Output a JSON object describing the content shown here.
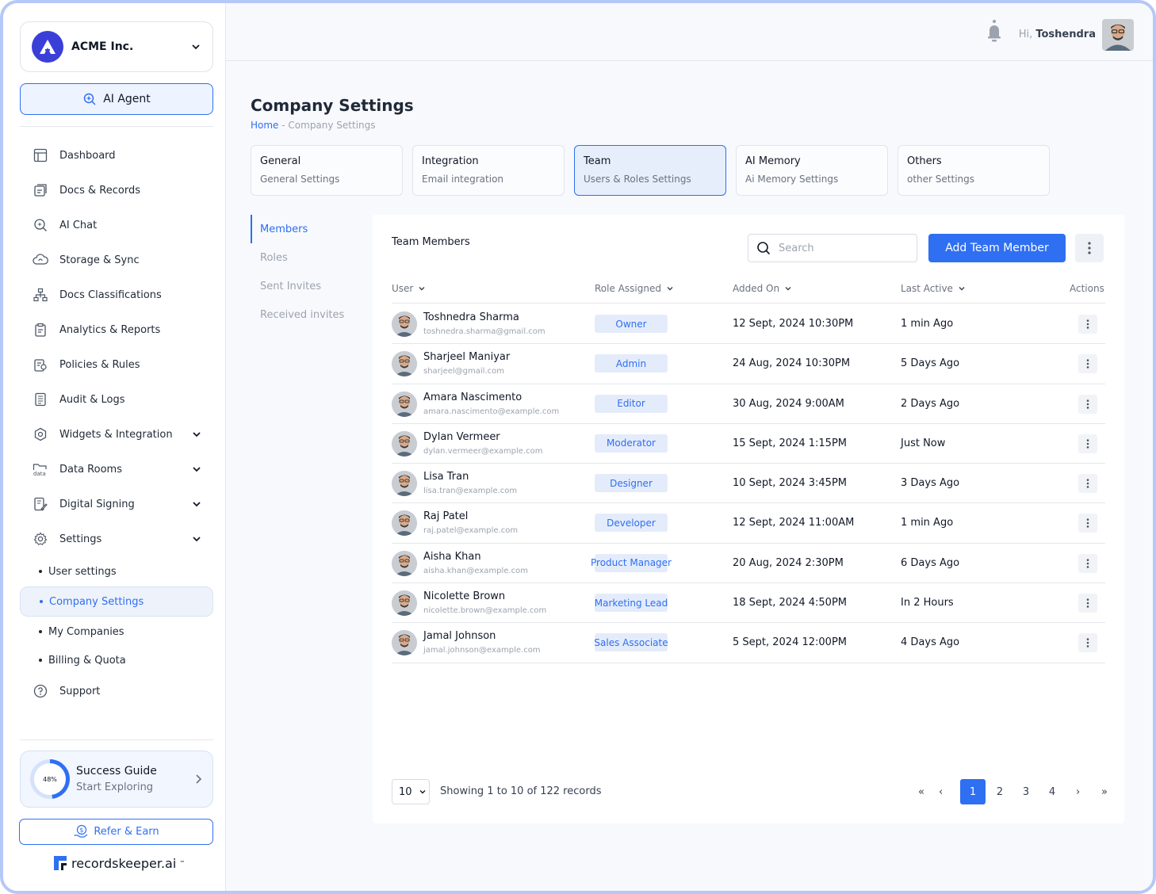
{
  "org": {
    "name": "ACME Inc.",
    "logo_letter": "A"
  },
  "ai_agent": {
    "label": "AI Agent"
  },
  "nav": [
    {
      "label": "Dashboard",
      "icon": "dashboard-icon"
    },
    {
      "label": "Docs & Records",
      "icon": "docs-icon"
    },
    {
      "label": "AI Chat",
      "icon": "ai-chat-icon"
    },
    {
      "label": "Storage & Sync",
      "icon": "cloud-sync-icon"
    },
    {
      "label": "Docs Classifications",
      "icon": "hierarchy-icon"
    },
    {
      "label": "Analytics & Reports",
      "icon": "clipboard-icon"
    },
    {
      "label": "Policies & Rules",
      "icon": "policy-icon"
    },
    {
      "label": "Audit & Logs",
      "icon": "log-icon"
    },
    {
      "label": "Widgets & Integration",
      "icon": "widget-icon"
    },
    {
      "label": "Data Rooms",
      "icon": "folder-data-icon"
    },
    {
      "label": "Digital Signing",
      "icon": "signing-icon"
    },
    {
      "label": "Settings",
      "icon": "gear-icon"
    }
  ],
  "settings_sub": [
    "User settings",
    "Company Settings",
    "My Companies",
    "Billing & Quota"
  ],
  "support": {
    "label": "Support"
  },
  "guide": {
    "title": "Success Guide",
    "subtitle": "Start Exploring",
    "percent": "48%"
  },
  "refer": {
    "label": "Refer & Earn"
  },
  "brand": {
    "name": "recordskeeper.ai",
    "tm": "™"
  },
  "topbar": {
    "greeting": "Hi,",
    "user": "Toshendra"
  },
  "page": {
    "title": "Company Settings",
    "crumb_home": "Home",
    "crumb_sep": " - ",
    "crumb_current": "Company Settings"
  },
  "tabs": [
    {
      "title": "General",
      "subtitle": "General Settings"
    },
    {
      "title": "Integration",
      "subtitle": "Email integration"
    },
    {
      "title": "Team",
      "subtitle": "Users & Roles Settings"
    },
    {
      "title": "AI Memory",
      "subtitle": "Ai Memory Settings"
    },
    {
      "title": "Others",
      "subtitle": "other Settings"
    }
  ],
  "subnav": [
    "Members",
    "Roles",
    "Sent Invites",
    "Received invites"
  ],
  "team": {
    "title": "Team Members",
    "search_placeholder": "Search",
    "add_label": "Add Team Member",
    "columns": {
      "user": "User",
      "role": "Role Assigned",
      "added": "Added On",
      "last": "Last Active",
      "actions": "Actions"
    },
    "rows": [
      {
        "name": "Toshnedra Sharma",
        "email": "toshnedra.sharma@gmail.com",
        "role": "Owner",
        "added": "12 Sept, 2024 10:30PM",
        "last": "1 min Ago"
      },
      {
        "name": "Sharjeel Maniyar",
        "email": "sharjeel@gmail.com",
        "role": "Admin",
        "added": "24 Aug, 2024 10:30PM",
        "last": "5 Days Ago"
      },
      {
        "name": "Amara Nascimento",
        "email": "amara.nascimento@example.com",
        "role": "Editor",
        "added": "30 Aug, 2024 9:00AM",
        "last": "2 Days Ago"
      },
      {
        "name": "Dylan Vermeer",
        "email": "dylan.vermeer@example.com",
        "role": "Moderator",
        "added": "15 Sept, 2024 1:15PM",
        "last": "Just Now"
      },
      {
        "name": "Lisa Tran",
        "email": "lisa.tran@example.com",
        "role": "Designer",
        "added": "10 Sept, 2024 3:45PM",
        "last": "3 Days Ago"
      },
      {
        "name": "Raj Patel",
        "email": "raj.patel@example.com",
        "role": "Developer",
        "added": "12 Sept, 2024 11:00AM",
        "last": "1 min Ago"
      },
      {
        "name": "Aisha Khan",
        "email": "aisha.khan@example.com",
        "role": "Product Manager",
        "added": "20 Aug, 2024 2:30PM",
        "last": "6 Days Ago"
      },
      {
        "name": "Nicolette Brown",
        "email": "nicolette.brown@example.com",
        "role": "Marketing Lead",
        "added": "18 Sept, 2024 4:50PM",
        "last": "In 2 Hours"
      },
      {
        "name": "Jamal Johnson",
        "email": "jamal.johnson@example.com",
        "role": "Sales Associate",
        "added": "5 Sept, 2024 12:00PM",
        "last": "4 Days Ago"
      }
    ]
  },
  "pager": {
    "size": "10",
    "info": "Showing 1 to 10 of 122 records",
    "first": "«",
    "prev": "‹",
    "next": "›",
    "last": "»",
    "pages": [
      "1",
      "2",
      "3",
      "4"
    ]
  },
  "colors": {
    "accent": "#2f6ff2",
    "accent_light": "#e4ecfb",
    "frame": "#b5c8f7"
  }
}
